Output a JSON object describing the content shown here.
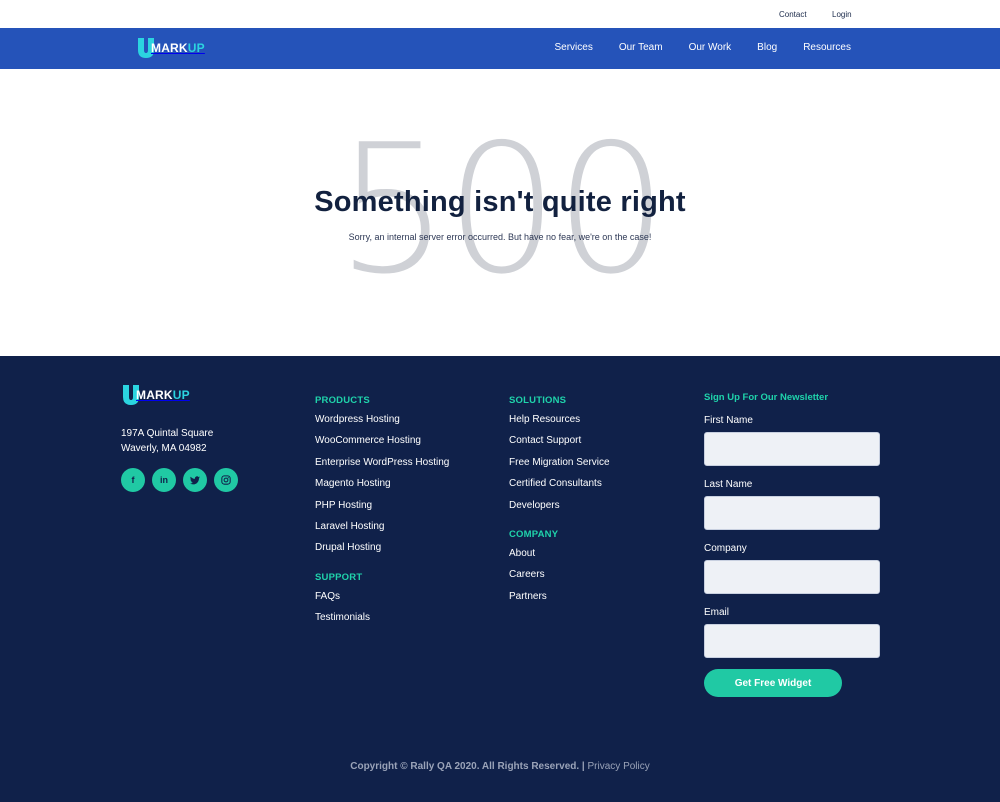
{
  "topbar": {
    "contact": "Contact",
    "login": "Login"
  },
  "brand": {
    "logo_letter": "U",
    "logo_mark": "MARK",
    "logo_up": "UP"
  },
  "nav": {
    "items": [
      "Services",
      "Our Team",
      "Our Work",
      "Blog",
      "Resources"
    ]
  },
  "hero": {
    "code": "500",
    "title": "Something isn't quite right",
    "message": "Sorry, an internal server error occurred. But have no fear, we're on the case!"
  },
  "footer": {
    "address_line1": "197A Quintal Square",
    "address_line2": "Waverly, MA 04982",
    "socials": [
      {
        "icon": "facebook-icon",
        "glyph": "f"
      },
      {
        "icon": "linkedin-icon",
        "glyph": "in"
      },
      {
        "icon": "twitter-icon",
        "glyph": "🐦"
      },
      {
        "icon": "instagram-icon",
        "glyph": "◎"
      }
    ],
    "products": {
      "heading": "PRODUCTS",
      "links": [
        "Wordpress Hosting",
        "WooCommerce Hosting",
        "Enterprise WordPress Hosting",
        "Magento Hosting",
        "PHP Hosting",
        "Laravel Hosting",
        "Drupal Hosting"
      ]
    },
    "support": {
      "heading": "SUPPORT",
      "links": [
        "FAQs",
        "Testimonials"
      ]
    },
    "solutions": {
      "heading": "SOLUTIONS",
      "links": [
        "Help Resources",
        "Contact Support",
        "Free Migration Service",
        "Certified Consultants",
        "Developers"
      ]
    },
    "company": {
      "heading": "COMPANY",
      "links": [
        "About",
        "Careers",
        "Partners"
      ]
    },
    "newsletter": {
      "heading": "Sign Up For Our Newsletter",
      "first_name_label": "First Name",
      "last_name_label": "Last Name",
      "company_label": "Company",
      "email_label": "Email",
      "button": "Get Free Widget"
    },
    "copyright": "Copyright © Rally QA 2020. All Rights Reserved. |",
    "privacy": "Privacy Policy"
  },
  "colors": {
    "nav_bg": "#2553b9",
    "footer_bg": "#10214a",
    "accent": "#20c9a4",
    "heading_accent": "#1fd3ab"
  }
}
